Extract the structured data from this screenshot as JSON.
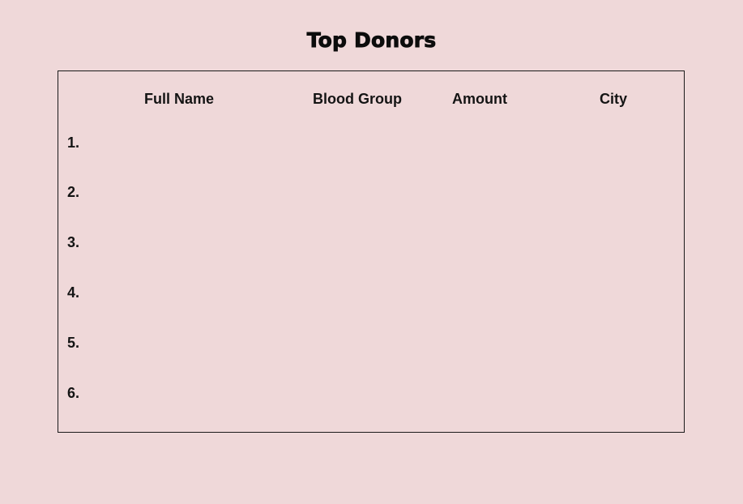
{
  "page": {
    "title": "Top Donors"
  },
  "table": {
    "columns": [
      "Full Name",
      "Blood Group",
      "Amount",
      "City"
    ],
    "rows": [
      {
        "index": "1.",
        "full_name": "",
        "blood_group": "",
        "amount": "",
        "city": ""
      },
      {
        "index": "2.",
        "full_name": "",
        "blood_group": "",
        "amount": "",
        "city": ""
      },
      {
        "index": "3.",
        "full_name": "",
        "blood_group": "",
        "amount": "",
        "city": ""
      },
      {
        "index": "4.",
        "full_name": "",
        "blood_group": "",
        "amount": "",
        "city": ""
      },
      {
        "index": "5.",
        "full_name": "",
        "blood_group": "",
        "amount": "",
        "city": ""
      },
      {
        "index": "6.",
        "full_name": "",
        "blood_group": "",
        "amount": "",
        "city": ""
      }
    ]
  },
  "colors": {
    "background": "#efd8d9",
    "text": "#141414",
    "border": "#1a1a1a"
  }
}
